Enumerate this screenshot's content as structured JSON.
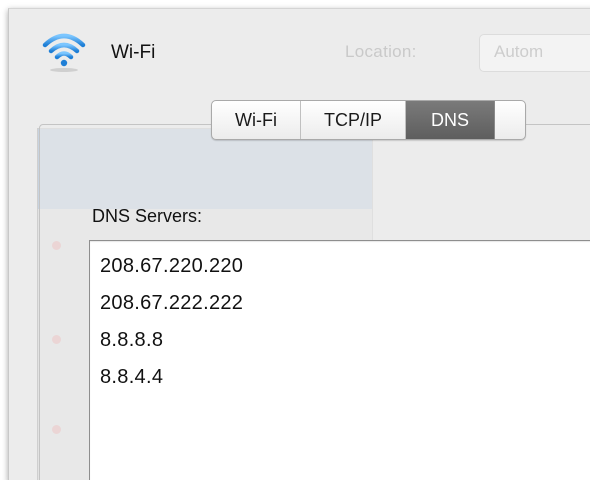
{
  "window": {
    "title": "Wi-Fi",
    "title_icon": "wifi-icon",
    "location_label": "Location:",
    "location_value": "Autom"
  },
  "tabs": [
    {
      "label": "Wi-Fi",
      "active": false
    },
    {
      "label": "TCP/IP",
      "active": false
    },
    {
      "label": "DNS",
      "active": true
    }
  ],
  "dns": {
    "label": "DNS Servers:",
    "servers": [
      "208.67.220.220",
      "208.67.222.222",
      "8.8.8.8",
      "8.8.4.4"
    ]
  },
  "colors": {
    "wifi_blue": "#3a9be8",
    "active_tab": "#666666",
    "window_bg": "#ececec"
  }
}
